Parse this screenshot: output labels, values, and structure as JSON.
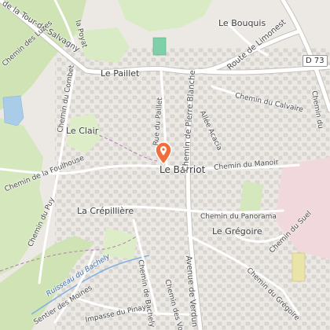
{
  "places": {
    "le_bouquis": "Le Bouquis",
    "le_paillet": "Le Paillet",
    "le_clair": "Le Clair",
    "le_barriot": "Le Barriot",
    "la_crepilliere": "La Crépillière",
    "le_gregoire": "Le Grégoire"
  },
  "roads": {
    "tour_salvagny": "de la Tour-de-Salvagny",
    "luzes": "Chemin des Luzes",
    "combet": "Chemin du Combet",
    "foulhouse": "Chemin de la Foulhouse",
    "puy": "Chemin du Puy",
    "paillet": "Rue du Paillet",
    "pierre_blanche": "Chemin de Pierre Blanche",
    "limonest": "Route de Limonest",
    "calvaire": "Chemin du Calvaire",
    "acacia": "Allée Acacia",
    "manoir": "Chemin du Manoir",
    "panorama": "Chemin du Panorama",
    "suel": "Chemin du Suel",
    "gregoire": "Chemin du Grégoire",
    "bachely": "Chemin de Bachely",
    "pinay": "Impasse du Pinay",
    "verdun": "Avenue de Verdun",
    "moines": "Sentier des Moines",
    "la_poyat": "la Poyat",
    "chemin_du": "Chemin du",
    "chemin_des_voy": "Chemin des Voy"
  },
  "water": {
    "bachely": "Ruisseau du Bachely"
  },
  "shield": {
    "d73": "D 73"
  },
  "colors": {
    "pin": "#f06e3c",
    "forest": "#cfe3b4",
    "water": "#a9cce8",
    "road": "#ffffff",
    "building": "#d6d2cd",
    "boundary": "#b07cb4"
  }
}
